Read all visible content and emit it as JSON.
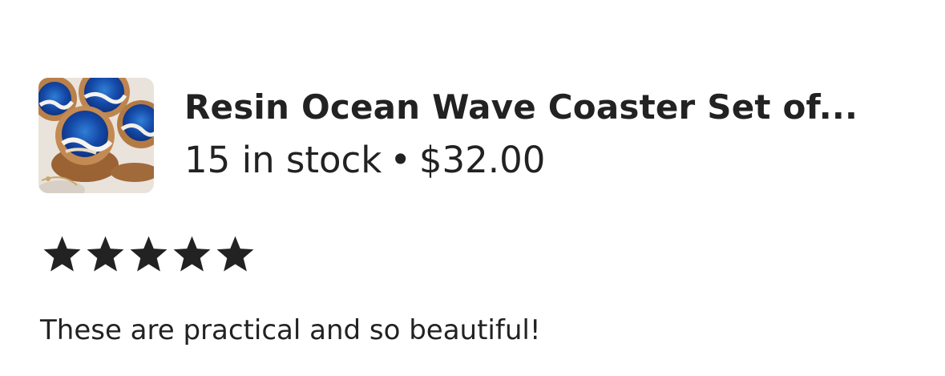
{
  "listing": {
    "thumbnail_icon": "product-thumbnail",
    "title": "Resin Ocean Wave Coaster Set of...",
    "stock": "15 in stock",
    "separator": "•",
    "price": "$32.00"
  },
  "rating": {
    "value": 5,
    "max": 5,
    "icon": "star-icon",
    "color": "#222222"
  },
  "review": {
    "text": "These are practical and so beautiful!"
  }
}
